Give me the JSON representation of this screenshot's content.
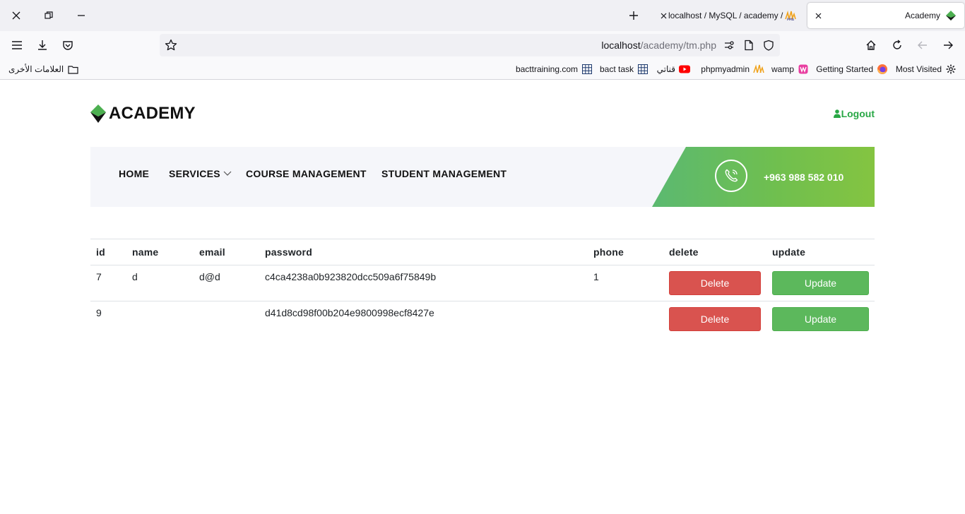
{
  "browser": {
    "tabs": [
      {
        "title": "localhost / MySQL / academy / ",
        "active": false
      },
      {
        "title": "Academy",
        "active": true
      }
    ],
    "url": {
      "host": "localhost",
      "path": "/academy/tm.php"
    },
    "bookmarks": [
      {
        "label": "Most Visited",
        "icon": "gear-icon"
      },
      {
        "label": "Getting Started",
        "icon": "firefox-icon"
      },
      {
        "label": "wamp",
        "icon": "wamp-icon"
      },
      {
        "label": "phpmyadmin",
        "icon": "pma-icon"
      },
      {
        "label": "قناتي",
        "icon": "youtube-icon"
      },
      {
        "label": "bact task",
        "icon": "grid-icon"
      },
      {
        "label": "bacttraining.com",
        "icon": "grid-icon"
      },
      {
        "label": "العلامات الأخرى",
        "icon": "folder-icon"
      }
    ]
  },
  "site": {
    "logo_text": "ACADEMY",
    "logout_label": "Logout",
    "menu": [
      "HOME",
      "SERVICES",
      "COURSE MANAGEMENT",
      "STUDENT MANAGEMENT"
    ],
    "phone": "+963 988 582 010",
    "brand_color": "#28a745"
  },
  "table": {
    "headers": [
      "id",
      "name",
      "email",
      "password",
      "phone",
      "delete",
      "update"
    ],
    "rows": [
      {
        "id": "7",
        "name": "d",
        "email": "d@d",
        "password": "c4ca4238a0b923820dcc509a6f75849b",
        "phone": "1",
        "delete": "Delete",
        "update": "Update"
      },
      {
        "id": "9",
        "name": "",
        "email": "",
        "password": "d41d8cd98f00b204e9800998ecf8427e",
        "phone": "",
        "delete": "Delete",
        "update": "Update"
      }
    ]
  }
}
